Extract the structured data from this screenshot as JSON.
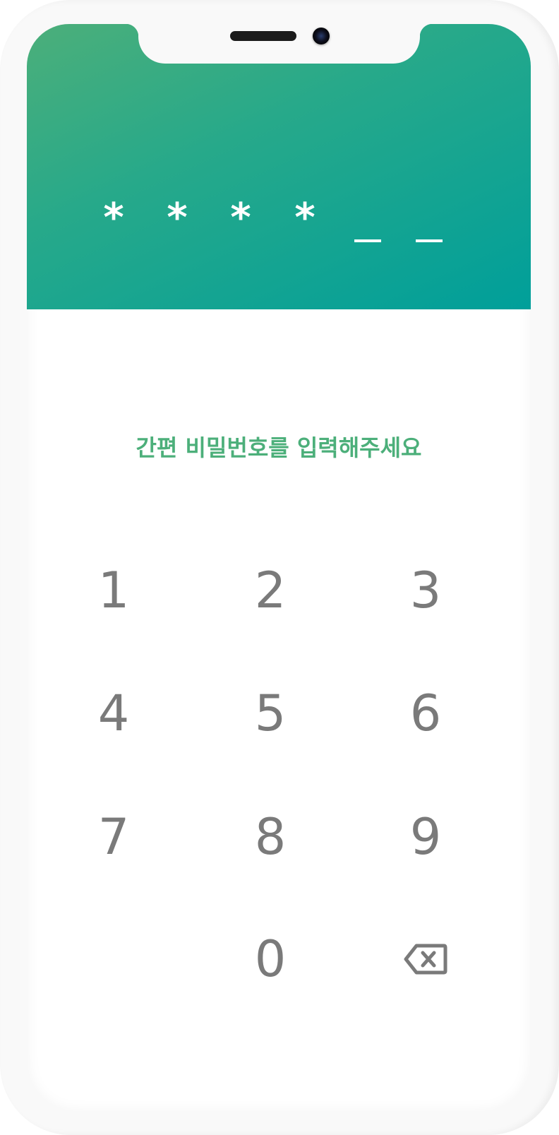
{
  "pin": {
    "slots": [
      {
        "symbol": "*",
        "filled": true
      },
      {
        "symbol": "*",
        "filled": true
      },
      {
        "symbol": "*",
        "filled": true
      },
      {
        "symbol": "*",
        "filled": true
      },
      {
        "symbol": "",
        "filled": false
      },
      {
        "symbol": "",
        "filled": false
      }
    ]
  },
  "prompt": "간편 비밀번호를 입력해주세요",
  "keypad": {
    "keys": [
      "1",
      "2",
      "3",
      "4",
      "5",
      "6",
      "7",
      "8",
      "9",
      "0"
    ],
    "backspace_icon": "backspace-icon"
  },
  "colors": {
    "header_start": "#4caf7a",
    "header_end": "#009f9a",
    "prompt": "#4caf7a",
    "key_text": "#7a7a7a"
  }
}
